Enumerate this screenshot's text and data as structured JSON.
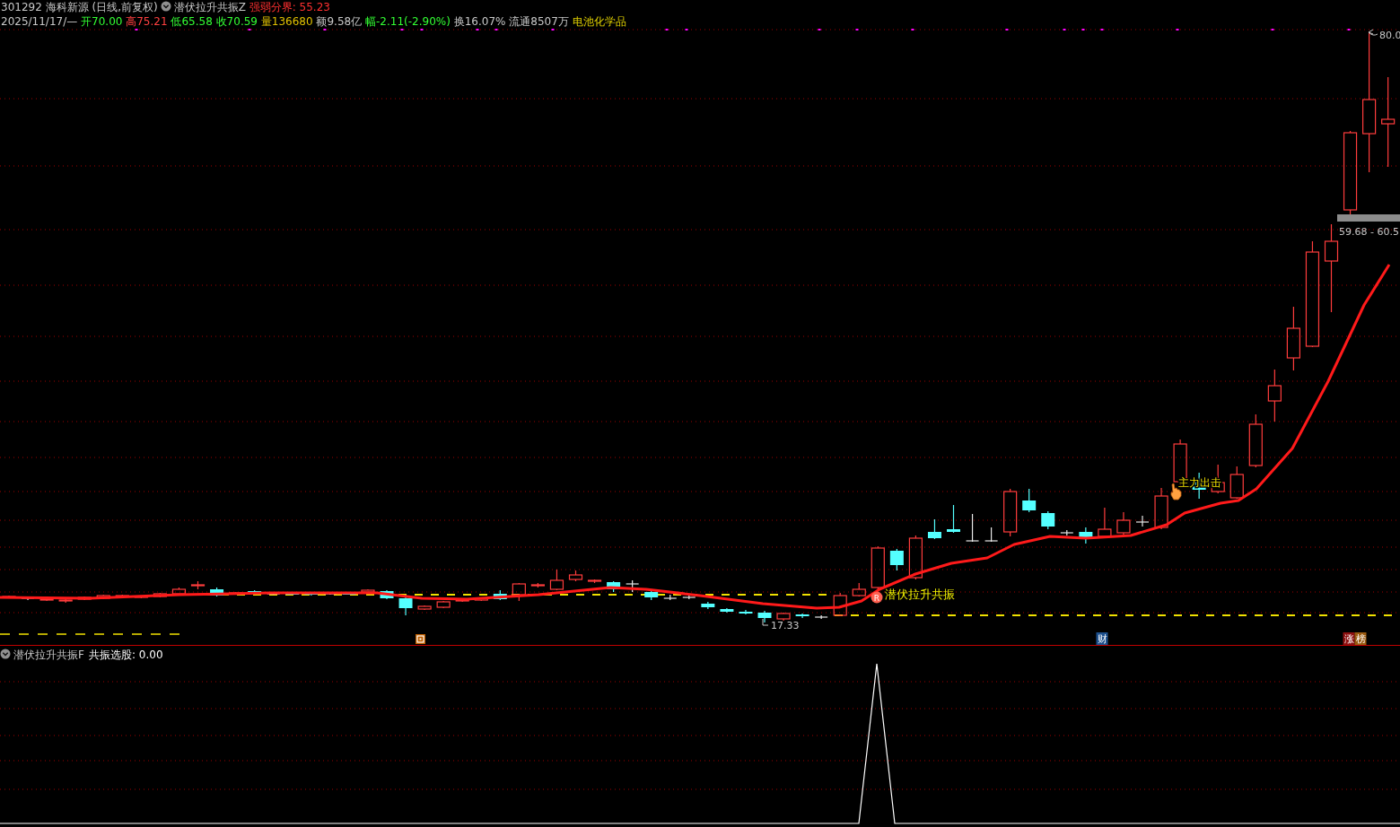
{
  "header": {
    "code_name": "301292 海科新源",
    "period": "(日线,前复权)",
    "indicator": "潜伏拉升共振Z",
    "threshold": "强弱分界: 55.23"
  },
  "quote": [
    {
      "text": "2025/11/17/—",
      "color": "#c8c8c8"
    },
    {
      "text": "开70.00",
      "color": "#33ff33"
    },
    {
      "text": "高75.21",
      "color": "#ff4040"
    },
    {
      "text": "低65.58",
      "color": "#33ff33"
    },
    {
      "text": "收70.59",
      "color": "#33ff33"
    },
    {
      "text": "量136680",
      "color": "#e0c000"
    },
    {
      "text": "额9.58亿",
      "color": "#c8c8c8"
    },
    {
      "text": "幅-2.11(-2.90%)",
      "color": "#33ff33"
    },
    {
      "text": "换16.07%",
      "color": "#c8c8c8"
    },
    {
      "text": "流通8507万",
      "color": "#c8c8c8"
    },
    {
      "text": "电池化学品",
      "color": "#e0d000"
    }
  ],
  "price_chart": {
    "high_label": "80.0",
    "zone_label": "59.68 - 60.5",
    "low_label": "17.33",
    "signals": [
      {
        "kind": "resonance",
        "label": "潜伏拉升共振",
        "badge": "R"
      },
      {
        "kind": "main_force",
        "label": "主力出击"
      }
    ],
    "markers": [
      {
        "kind": "icon"
      },
      {
        "kind": "text",
        "label": "财",
        "color": "#1c4f8c"
      },
      {
        "kind": "text",
        "label": "涨",
        "color": "#8c1010"
      },
      {
        "kind": "text",
        "label": "榜",
        "color": "#9a5a10"
      }
    ]
  },
  "sub_chart": {
    "indicator": "潜伏拉升共振F",
    "value_label": "共振选股: 0.00"
  }
}
